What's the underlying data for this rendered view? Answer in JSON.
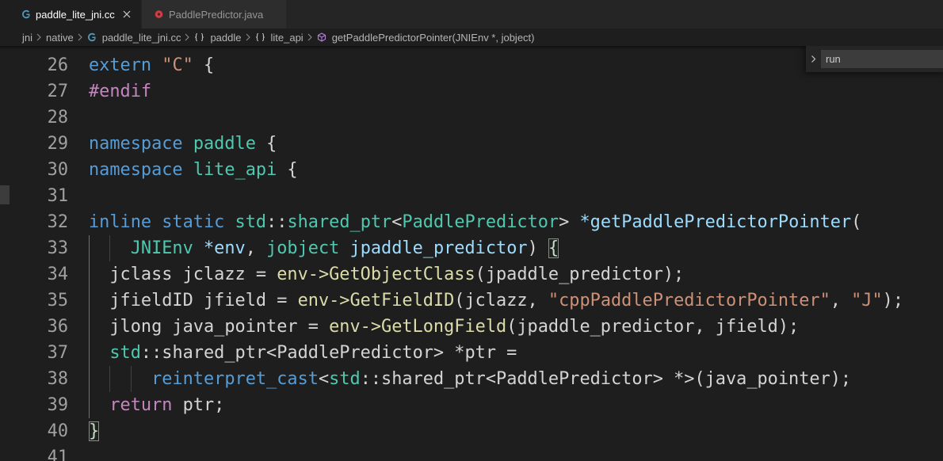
{
  "tabs": [
    {
      "label": "paddle_lite_jni.cc",
      "icon": "cpp-file-icon",
      "active": true
    },
    {
      "label": "PaddlePredictor.java",
      "icon": "java-file-icon",
      "active": false
    }
  ],
  "breadcrumb": {
    "items": [
      {
        "label": "jni"
      },
      {
        "label": "native"
      },
      {
        "label": "paddle_lite_jni.cc",
        "icon": "cpp-file-icon"
      },
      {
        "label": "paddle",
        "icon": "namespace-icon"
      },
      {
        "label": "lite_api",
        "icon": "namespace-icon"
      },
      {
        "label": "getPaddlePredictorPointer(JNIEnv *, jobject)",
        "icon": "method-icon"
      }
    ]
  },
  "find_widget": {
    "query": "run"
  },
  "code": {
    "default_color": "#d4d4d4",
    "lines": [
      {
        "number": "26",
        "tokens": [
          {
            "text": "extern",
            "color": "#569cd6"
          },
          {
            "text": " "
          },
          {
            "text": "\"C\"",
            "color": "#ce9178"
          },
          {
            "text": " {"
          }
        ]
      },
      {
        "number": "27",
        "tokens": [
          {
            "text": "#endif",
            "color": "#c586c0"
          }
        ]
      },
      {
        "number": "28",
        "tokens": []
      },
      {
        "number": "29",
        "tokens": [
          {
            "text": "namespace",
            "color": "#569cd6"
          },
          {
            "text": " "
          },
          {
            "text": "paddle",
            "color": "#4ec9b0"
          },
          {
            "text": " {"
          }
        ]
      },
      {
        "number": "30",
        "tokens": [
          {
            "text": "namespace",
            "color": "#569cd6"
          },
          {
            "text": " "
          },
          {
            "text": "lite_api",
            "color": "#4ec9b0"
          },
          {
            "text": " {"
          }
        ]
      },
      {
        "number": "31",
        "tokens": []
      },
      {
        "number": "32",
        "tokens": [
          {
            "text": "inline static",
            "color": "#569cd6"
          },
          {
            "text": " "
          },
          {
            "text": "std",
            "color": "#4ec9b0"
          },
          {
            "text": "::"
          },
          {
            "text": "shared_ptr",
            "color": "#4ec9b0"
          },
          {
            "text": "<"
          },
          {
            "text": "PaddlePredictor",
            "color": "#4ec9b0"
          },
          {
            "text": "> "
          },
          {
            "text": "*getPaddlePredictorPointer",
            "color": "#9cdcfe"
          },
          {
            "text": "("
          }
        ]
      },
      {
        "number": "33",
        "tokens": [
          {
            "text": "    "
          },
          {
            "text": "JNIEnv",
            "color": "#4ec9b0"
          },
          {
            "text": " "
          },
          {
            "text": "*env",
            "color": "#9cdcfe"
          },
          {
            "text": ", "
          },
          {
            "text": "jobject",
            "color": "#4ec9b0"
          },
          {
            "text": " "
          },
          {
            "text": "jpaddle_predictor",
            "color": "#9cdcfe"
          },
          {
            "text": ") "
          },
          {
            "text": "{",
            "bracket_match": true
          }
        ]
      },
      {
        "number": "34",
        "tokens": [
          {
            "text": "  jclass jclazz = "
          },
          {
            "text": "env->GetObjectClass",
            "color": "#dcdcaa"
          },
          {
            "text": "(jpaddle_predictor);"
          }
        ]
      },
      {
        "number": "35",
        "tokens": [
          {
            "text": "  jfieldID jfield = "
          },
          {
            "text": "env->GetFieldID",
            "color": "#dcdcaa"
          },
          {
            "text": "(jclazz, "
          },
          {
            "text": "\"cppPaddlePredictorPointer\"",
            "color": "#ce9178"
          },
          {
            "text": ", "
          },
          {
            "text": "\"J\"",
            "color": "#ce9178"
          },
          {
            "text": ");"
          }
        ]
      },
      {
        "number": "36",
        "tokens": [
          {
            "text": "  jlong java_pointer = "
          },
          {
            "text": "env->GetLongField",
            "color": "#dcdcaa"
          },
          {
            "text": "(jpaddle_predictor, jfield);"
          }
        ]
      },
      {
        "number": "37",
        "tokens": [
          {
            "text": "  "
          },
          {
            "text": "std",
            "color": "#4ec9b0"
          },
          {
            "text": "::shared_ptr<PaddlePredictor> *ptr ="
          }
        ]
      },
      {
        "number": "38",
        "tokens": [
          {
            "text": "      "
          },
          {
            "text": "reinterpret_cast",
            "color": "#569cd6"
          },
          {
            "text": "<"
          },
          {
            "text": "std",
            "color": "#4ec9b0"
          },
          {
            "text": "::shared_ptr<PaddlePredictor> *>(java_pointer);"
          }
        ]
      },
      {
        "number": "39",
        "tokens": [
          {
            "text": "  "
          },
          {
            "text": "return",
            "color": "#c586c0"
          },
          {
            "text": " ptr;"
          }
        ]
      },
      {
        "number": "40",
        "tokens": [
          {
            "text": "}",
            "bracket_match": true
          }
        ]
      },
      {
        "number": "41",
        "tokens": []
      }
    ]
  }
}
